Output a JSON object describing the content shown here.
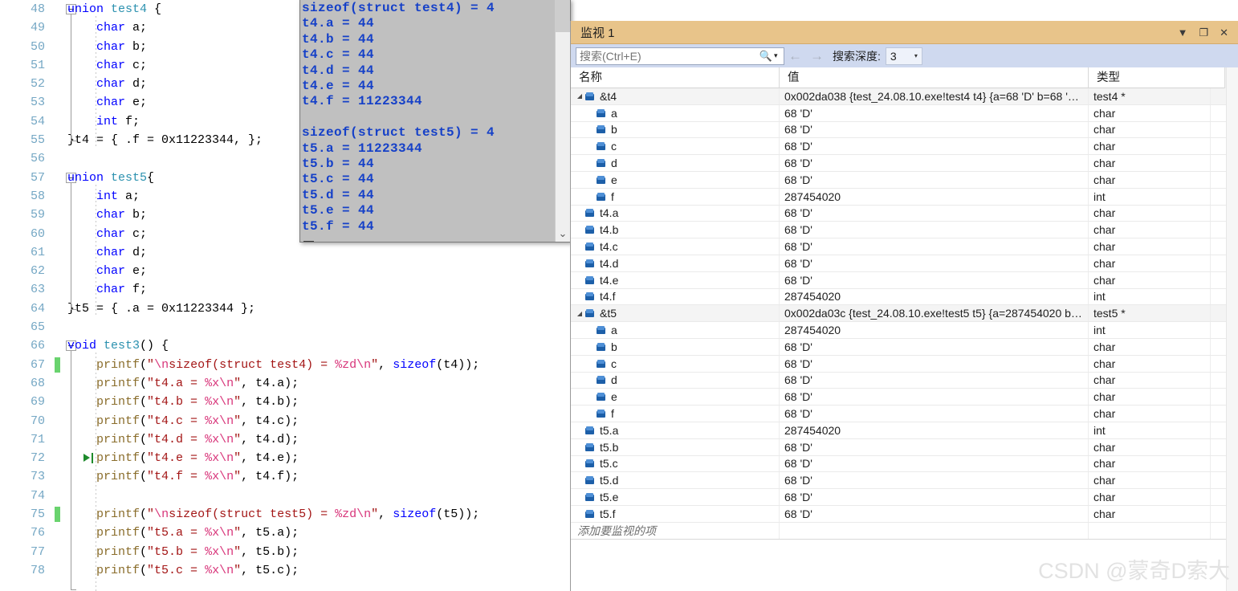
{
  "editor": {
    "first_line_number": 48,
    "lines": [
      {
        "n": 48,
        "fold": true,
        "indent": 0,
        "tokens": [
          {
            "t": "union ",
            "c": "kw"
          },
          {
            "t": "test4",
            "c": "typ"
          },
          {
            "t": " {",
            "c": "pun"
          }
        ]
      },
      {
        "n": 49,
        "tokens": [
          {
            "t": "    ",
            "c": "pun"
          },
          {
            "t": "char",
            "c": "kw"
          },
          {
            "t": " a;",
            "c": "pun"
          }
        ]
      },
      {
        "n": 50,
        "tokens": [
          {
            "t": "    ",
            "c": "pun"
          },
          {
            "t": "char",
            "c": "kw"
          },
          {
            "t": " b;",
            "c": "pun"
          }
        ]
      },
      {
        "n": 51,
        "tokens": [
          {
            "t": "    ",
            "c": "pun"
          },
          {
            "t": "char",
            "c": "kw"
          },
          {
            "t": " c;",
            "c": "pun"
          }
        ]
      },
      {
        "n": 52,
        "tokens": [
          {
            "t": "    ",
            "c": "pun"
          },
          {
            "t": "char",
            "c": "kw"
          },
          {
            "t": " d;",
            "c": "pun"
          }
        ]
      },
      {
        "n": 53,
        "tokens": [
          {
            "t": "    ",
            "c": "pun"
          },
          {
            "t": "char",
            "c": "kw"
          },
          {
            "t": " e;",
            "c": "pun"
          }
        ]
      },
      {
        "n": 54,
        "tokens": [
          {
            "t": "    ",
            "c": "pun"
          },
          {
            "t": "int",
            "c": "kw"
          },
          {
            "t": " f;",
            "c": "pun"
          }
        ]
      },
      {
        "n": 55,
        "tokens": [
          {
            "t": "}t4 = { .f = 0x11223344, };",
            "c": "pun"
          }
        ]
      },
      {
        "n": 56,
        "tokens": []
      },
      {
        "n": 57,
        "fold": true,
        "tokens": [
          {
            "t": "union ",
            "c": "kw"
          },
          {
            "t": "test5",
            "c": "typ"
          },
          {
            "t": "{",
            "c": "pun"
          }
        ]
      },
      {
        "n": 58,
        "tokens": [
          {
            "t": "    ",
            "c": "pun"
          },
          {
            "t": "int",
            "c": "kw"
          },
          {
            "t": " a;",
            "c": "pun"
          }
        ]
      },
      {
        "n": 59,
        "tokens": [
          {
            "t": "    ",
            "c": "pun"
          },
          {
            "t": "char",
            "c": "kw"
          },
          {
            "t": " b;",
            "c": "pun"
          }
        ]
      },
      {
        "n": 60,
        "tokens": [
          {
            "t": "    ",
            "c": "pun"
          },
          {
            "t": "char",
            "c": "kw"
          },
          {
            "t": " c;",
            "c": "pun"
          }
        ]
      },
      {
        "n": 61,
        "tokens": [
          {
            "t": "    ",
            "c": "pun"
          },
          {
            "t": "char",
            "c": "kw"
          },
          {
            "t": " d;",
            "c": "pun"
          }
        ]
      },
      {
        "n": 62,
        "tokens": [
          {
            "t": "    ",
            "c": "pun"
          },
          {
            "t": "char",
            "c": "kw"
          },
          {
            "t": " e;",
            "c": "pun"
          }
        ]
      },
      {
        "n": 63,
        "tokens": [
          {
            "t": "    ",
            "c": "pun"
          },
          {
            "t": "char",
            "c": "kw"
          },
          {
            "t": " f;",
            "c": "pun"
          }
        ]
      },
      {
        "n": 64,
        "tokens": [
          {
            "t": "}t5 = { .a = 0x11223344 };",
            "c": "pun"
          }
        ]
      },
      {
        "n": 65,
        "tokens": []
      },
      {
        "n": 66,
        "fold": true,
        "tokens": [
          {
            "t": "void ",
            "c": "kw"
          },
          {
            "t": "test3",
            "c": "typ"
          },
          {
            "t": "() {",
            "c": "pun"
          }
        ]
      },
      {
        "n": 67,
        "changebar": true,
        "tokens": [
          {
            "t": "    ",
            "c": "pun"
          },
          {
            "t": "printf",
            "c": "fn"
          },
          {
            "t": "(",
            "c": "pun"
          },
          {
            "t": "\"",
            "c": "str"
          },
          {
            "t": "\\n",
            "c": "esc"
          },
          {
            "t": "sizeof(struct test4) = ",
            "c": "str"
          },
          {
            "t": "%zd",
            "c": "esc"
          },
          {
            "t": "\\n",
            "c": "esc"
          },
          {
            "t": "\"",
            "c": "str"
          },
          {
            "t": ", ",
            "c": "pun"
          },
          {
            "t": "sizeof",
            "c": "kw"
          },
          {
            "t": "(t4));",
            "c": "pun"
          }
        ]
      },
      {
        "n": 68,
        "tokens": [
          {
            "t": "    ",
            "c": "pun"
          },
          {
            "t": "printf",
            "c": "fn"
          },
          {
            "t": "(",
            "c": "pun"
          },
          {
            "t": "\"t4.a = ",
            "c": "str"
          },
          {
            "t": "%x",
            "c": "esc"
          },
          {
            "t": "\\n",
            "c": "esc"
          },
          {
            "t": "\"",
            "c": "str"
          },
          {
            "t": ", t4.a);",
            "c": "pun"
          }
        ]
      },
      {
        "n": 69,
        "tokens": [
          {
            "t": "    ",
            "c": "pun"
          },
          {
            "t": "printf",
            "c": "fn"
          },
          {
            "t": "(",
            "c": "pun"
          },
          {
            "t": "\"t4.b = ",
            "c": "str"
          },
          {
            "t": "%x",
            "c": "esc"
          },
          {
            "t": "\\n",
            "c": "esc"
          },
          {
            "t": "\"",
            "c": "str"
          },
          {
            "t": ", t4.b);",
            "c": "pun"
          }
        ]
      },
      {
        "n": 70,
        "tokens": [
          {
            "t": "    ",
            "c": "pun"
          },
          {
            "t": "printf",
            "c": "fn"
          },
          {
            "t": "(",
            "c": "pun"
          },
          {
            "t": "\"t4.c = ",
            "c": "str"
          },
          {
            "t": "%x",
            "c": "esc"
          },
          {
            "t": "\\n",
            "c": "esc"
          },
          {
            "t": "\"",
            "c": "str"
          },
          {
            "t": ", t4.c);",
            "c": "pun"
          }
        ]
      },
      {
        "n": 71,
        "tokens": [
          {
            "t": "    ",
            "c": "pun"
          },
          {
            "t": "printf",
            "c": "fn"
          },
          {
            "t": "(",
            "c": "pun"
          },
          {
            "t": "\"t4.d = ",
            "c": "str"
          },
          {
            "t": "%x",
            "c": "esc"
          },
          {
            "t": "\\n",
            "c": "esc"
          },
          {
            "t": "\"",
            "c": "str"
          },
          {
            "t": ", t4.d);",
            "c": "pun"
          }
        ]
      },
      {
        "n": 72,
        "current": true,
        "tokens": [
          {
            "t": "    ",
            "c": "pun"
          },
          {
            "t": "printf",
            "c": "fn"
          },
          {
            "t": "(",
            "c": "pun"
          },
          {
            "t": "\"t4.e = ",
            "c": "str"
          },
          {
            "t": "%x",
            "c": "esc"
          },
          {
            "t": "\\n",
            "c": "esc"
          },
          {
            "t": "\"",
            "c": "str"
          },
          {
            "t": ", t4.e);",
            "c": "pun"
          }
        ]
      },
      {
        "n": 73,
        "tokens": [
          {
            "t": "    ",
            "c": "pun"
          },
          {
            "t": "printf",
            "c": "fn"
          },
          {
            "t": "(",
            "c": "pun"
          },
          {
            "t": "\"t4.f = ",
            "c": "str"
          },
          {
            "t": "%x",
            "c": "esc"
          },
          {
            "t": "\\n",
            "c": "esc"
          },
          {
            "t": "\"",
            "c": "str"
          },
          {
            "t": ", t4.f);",
            "c": "pun"
          }
        ]
      },
      {
        "n": 74,
        "tokens": []
      },
      {
        "n": 75,
        "changebar": true,
        "tokens": [
          {
            "t": "    ",
            "c": "pun"
          },
          {
            "t": "printf",
            "c": "fn"
          },
          {
            "t": "(",
            "c": "pun"
          },
          {
            "t": "\"",
            "c": "str"
          },
          {
            "t": "\\n",
            "c": "esc"
          },
          {
            "t": "sizeof(struct test5) = ",
            "c": "str"
          },
          {
            "t": "%zd",
            "c": "esc"
          },
          {
            "t": "\\n",
            "c": "esc"
          },
          {
            "t": "\"",
            "c": "str"
          },
          {
            "t": ", ",
            "c": "pun"
          },
          {
            "t": "sizeof",
            "c": "kw"
          },
          {
            "t": "(t5));",
            "c": "pun"
          }
        ]
      },
      {
        "n": 76,
        "tokens": [
          {
            "t": "    ",
            "c": "pun"
          },
          {
            "t": "printf",
            "c": "fn"
          },
          {
            "t": "(",
            "c": "pun"
          },
          {
            "t": "\"t5.a = ",
            "c": "str"
          },
          {
            "t": "%x",
            "c": "esc"
          },
          {
            "t": "\\n",
            "c": "esc"
          },
          {
            "t": "\"",
            "c": "str"
          },
          {
            "t": ", t5.a);",
            "c": "pun"
          }
        ]
      },
      {
        "n": 77,
        "tokens": [
          {
            "t": "    ",
            "c": "pun"
          },
          {
            "t": "printf",
            "c": "fn"
          },
          {
            "t": "(",
            "c": "pun"
          },
          {
            "t": "\"t5.b = ",
            "c": "str"
          },
          {
            "t": "%x",
            "c": "esc"
          },
          {
            "t": "\\n",
            "c": "esc"
          },
          {
            "t": "\"",
            "c": "str"
          },
          {
            "t": ", t5.b);",
            "c": "pun"
          }
        ]
      },
      {
        "n": 78,
        "tokens": [
          {
            "t": "    ",
            "c": "pun"
          },
          {
            "t": "printf",
            "c": "fn"
          },
          {
            "t": "(",
            "c": "pun"
          },
          {
            "t": "\"t5.c = ",
            "c": "str"
          },
          {
            "t": "%x",
            "c": "esc"
          },
          {
            "t": "\\n",
            "c": "esc"
          },
          {
            "t": "\"",
            "c": "str"
          },
          {
            "t": ", t5.c);",
            "c": "pun"
          }
        ]
      }
    ]
  },
  "console": {
    "lines": [
      "sizeof(struct test4) = 4",
      "t4.a = 44",
      "t4.b = 44",
      "t4.c = 44",
      "t4.d = 44",
      "t4.e = 44",
      "t4.f = 11223344",
      "",
      "sizeof(struct test5) = 4",
      "t5.a = 11223344",
      "t5.b = 44",
      "t5.c = 44",
      "t5.d = 44",
      "t5.e = 44",
      "t5.f = 44"
    ],
    "scroll_down_glyph": "⌄"
  },
  "watch": {
    "title": "监视 1",
    "title_buttons": {
      "menu": "▼",
      "maximize": "❐",
      "close": "✕"
    },
    "search": {
      "placeholder": "搜索(Ctrl+E)",
      "value": "",
      "icon": "🔍",
      "caret": "▾"
    },
    "nav": {
      "back": "←",
      "forward": "→"
    },
    "depth": {
      "label": "搜索深度:",
      "value": "3",
      "caret": "▾"
    },
    "columns": {
      "name": "名称",
      "value": "值",
      "type": "类型"
    },
    "scroll_up_glyph": "▲",
    "add_item_placeholder": "添加要监视的项",
    "rows": [
      {
        "indent": 0,
        "expander": "◢",
        "name": "&t4",
        "value": "0x002da038 {test_24.08.10.exe!test4 t4} {a=68 'D' b=68 '…",
        "type": "test4 *",
        "root": true
      },
      {
        "indent": 1,
        "name": "a",
        "value": "68 'D'",
        "type": "char"
      },
      {
        "indent": 1,
        "name": "b",
        "value": "68 'D'",
        "type": "char"
      },
      {
        "indent": 1,
        "name": "c",
        "value": "68 'D'",
        "type": "char"
      },
      {
        "indent": 1,
        "name": "d",
        "value": "68 'D'",
        "type": "char"
      },
      {
        "indent": 1,
        "name": "e",
        "value": "68 'D'",
        "type": "char"
      },
      {
        "indent": 1,
        "name": "f",
        "value": "287454020",
        "type": "int"
      },
      {
        "indent": 0,
        "name": "t4.a",
        "value": "68 'D'",
        "type": "char"
      },
      {
        "indent": 0,
        "name": "t4.b",
        "value": "68 'D'",
        "type": "char"
      },
      {
        "indent": 0,
        "name": "t4.c",
        "value": "68 'D'",
        "type": "char"
      },
      {
        "indent": 0,
        "name": "t4.d",
        "value": "68 'D'",
        "type": "char"
      },
      {
        "indent": 0,
        "name": "t4.e",
        "value": "68 'D'",
        "type": "char"
      },
      {
        "indent": 0,
        "name": "t4.f",
        "value": "287454020",
        "type": "int"
      },
      {
        "indent": 0,
        "expander": "◢",
        "name": "&t5",
        "value": "0x002da03c {test_24.08.10.exe!test5 t5} {a=287454020 b…",
        "type": "test5 *",
        "root": true
      },
      {
        "indent": 1,
        "name": "a",
        "value": "287454020",
        "type": "int"
      },
      {
        "indent": 1,
        "name": "b",
        "value": "68 'D'",
        "type": "char"
      },
      {
        "indent": 1,
        "name": "c",
        "value": "68 'D'",
        "type": "char"
      },
      {
        "indent": 1,
        "name": "d",
        "value": "68 'D'",
        "type": "char"
      },
      {
        "indent": 1,
        "name": "e",
        "value": "68 'D'",
        "type": "char"
      },
      {
        "indent": 1,
        "name": "f",
        "value": "68 'D'",
        "type": "char"
      },
      {
        "indent": 0,
        "name": "t5.a",
        "value": "287454020",
        "type": "int"
      },
      {
        "indent": 0,
        "name": "t5.b",
        "value": "68 'D'",
        "type": "char"
      },
      {
        "indent": 0,
        "name": "t5.c",
        "value": "68 'D'",
        "type": "char"
      },
      {
        "indent": 0,
        "name": "t5.d",
        "value": "68 'D'",
        "type": "char"
      },
      {
        "indent": 0,
        "name": "t5.e",
        "value": "68 'D'",
        "type": "char"
      },
      {
        "indent": 0,
        "name": "t5.f",
        "value": "68 'D'",
        "type": "char"
      }
    ]
  },
  "watermark": {
    "text": "CSDN @蒙奇D索大"
  },
  "colors": {
    "watch_title_bg": "#e8c48a",
    "watch_toolbar_bg": "#cfd9ef",
    "console_bg": "#c0c0c0",
    "console_text": "#1540c8",
    "keyword": "#0000ff",
    "type": "#2b91af",
    "string": "#a31515",
    "escape": "#d8357a",
    "function": "#8a6d2b",
    "line_number": "#74a7c4",
    "changebar": "#69d36e",
    "cube_icon": "#1d5fa8"
  }
}
